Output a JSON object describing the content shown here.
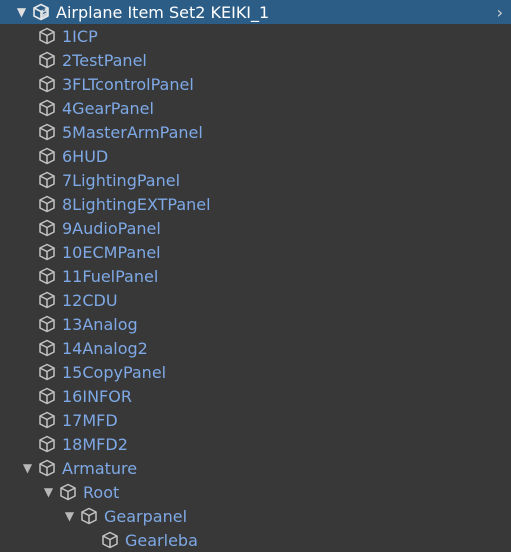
{
  "hierarchy": {
    "root": {
      "label": "Airplane Item Set2 KEIKI_1",
      "icon": "prefab-icon",
      "expanded": true,
      "has_submenu": true
    },
    "children": [
      {
        "label": "1ICP",
        "icon": "cube-icon"
      },
      {
        "label": "2TestPanel",
        "icon": "cube-icon"
      },
      {
        "label": "3FLTcontrolPanel",
        "icon": "cube-icon"
      },
      {
        "label": "4GearPanel",
        "icon": "cube-icon"
      },
      {
        "label": "5MasterArmPanel",
        "icon": "cube-icon"
      },
      {
        "label": "6HUD",
        "icon": "cube-icon"
      },
      {
        "label": "7LightingPanel",
        "icon": "cube-icon"
      },
      {
        "label": "8LightingEXTPanel",
        "icon": "cube-icon"
      },
      {
        "label": "9AudioPanel",
        "icon": "cube-icon"
      },
      {
        "label": "10ECMPanel",
        "icon": "cube-icon"
      },
      {
        "label": "11FuelPanel",
        "icon": "cube-icon"
      },
      {
        "label": "12CDU",
        "icon": "cube-icon"
      },
      {
        "label": "13Analog",
        "icon": "cube-icon"
      },
      {
        "label": "14Analog2",
        "icon": "cube-icon"
      },
      {
        "label": "15CopyPanel",
        "icon": "cube-icon"
      },
      {
        "label": "16INFOR",
        "icon": "cube-icon"
      },
      {
        "label": "17MFD",
        "icon": "cube-icon"
      },
      {
        "label": "18MFD2",
        "icon": "cube-icon"
      },
      {
        "label": "Armature",
        "icon": "cube-icon",
        "expanded": true
      },
      {
        "label": "Root",
        "icon": "cube-icon",
        "expanded": true
      },
      {
        "label": "Gearpanel",
        "icon": "cube-icon",
        "expanded": true
      },
      {
        "label": "Gearleba",
        "icon": "cube-icon"
      }
    ]
  },
  "colors": {
    "background": "#383838",
    "selection": "#2c5d87",
    "prefab_text": "#7ea9e6",
    "icon": "#c4c4c4"
  }
}
